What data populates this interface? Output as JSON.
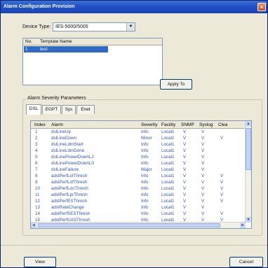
{
  "window": {
    "title": "Alarm Configuration Provision",
    "close": "×"
  },
  "device": {
    "label": "Device Type:",
    "value": "IES-5000/5005",
    "arrow": "▼"
  },
  "templates": {
    "headers": [
      "No.",
      "Template Name"
    ],
    "rows": [
      {
        "no": "1",
        "name": "test"
      }
    ]
  },
  "apply_label": "Apply To",
  "group_label": "Alarm Severity Parameters",
  "tabs": [
    "DSL",
    "EGPT",
    "Sys",
    "Enet"
  ],
  "grid": {
    "headers": [
      "Index",
      "Alarm",
      "Severity",
      "Facility",
      "SNMP",
      "Syslog",
      "Clea"
    ],
    "rows": [
      [
        "1",
        "dslLineUp",
        "Info",
        "Local1",
        "V",
        "V",
        ""
      ],
      [
        "2",
        "dslLineDown",
        "Minor",
        "Local1",
        "V",
        "V",
        "V"
      ],
      [
        "3",
        "dslLineLdmStart",
        "Info",
        "Local1",
        "V",
        "V",
        ""
      ],
      [
        "4",
        "dslLineLdmDone",
        "Info",
        "Local1",
        "V",
        "V",
        ""
      ],
      [
        "5",
        "dslLinePowerDownL2",
        "Info",
        "Local1",
        "V",
        "V",
        ""
      ],
      [
        "6",
        "dslLinePowerDownL0",
        "Info",
        "Local1",
        "V",
        "V",
        ""
      ],
      [
        "7",
        "dslLineFailure",
        "Major",
        "Local1",
        "V",
        "V",
        ""
      ],
      [
        "8",
        "adslPerfLolThresh",
        "Info",
        "Local1",
        "V",
        "V",
        "V"
      ],
      [
        "9",
        "adslPerfLofThresh",
        "Info",
        "Local1",
        "V",
        "V",
        "V"
      ],
      [
        "10",
        "adslPerfLosThresh",
        "Info",
        "Local1",
        "V",
        "V",
        "V"
      ],
      [
        "11",
        "adslPerfLprThresh",
        "Info",
        "Local1",
        "V",
        "V",
        "V"
      ],
      [
        "12",
        "adslPerfESThresh",
        "Info",
        "Local1",
        "V",
        "V",
        "V"
      ],
      [
        "13",
        "adslRateChange",
        "Info",
        "Local1",
        "V",
        "V",
        ""
      ],
      [
        "14",
        "adslPerfSESThresh",
        "Info",
        "Local1",
        "V",
        "V",
        "V"
      ],
      [
        "15",
        "adslPerfUASThresh",
        "Info",
        "Local1",
        "V",
        "V",
        "V"
      ]
    ]
  },
  "scroll": {
    "up": "▲",
    "down": "▼",
    "left": "◄",
    "right": "►"
  },
  "buttons": {
    "view": "View",
    "cancel": "Cancel"
  }
}
